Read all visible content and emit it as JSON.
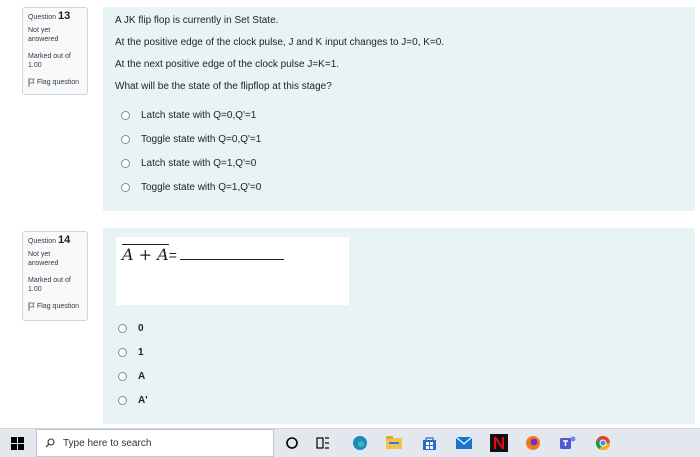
{
  "q13": {
    "label": "Question",
    "number": "13",
    "state": "Not yet answered",
    "mark": "Marked out of 1.00",
    "flag": "Flag question",
    "text": [
      "A JK flip flop is currently in Set State.",
      "At the positive edge of the clock pulse, J and K input changes to J=0, K=0.",
      "At the next positive edge of the clock pulse J=K=1.",
      "What will be the state of the flipflop at this stage?"
    ],
    "options": [
      "Latch state with Q=0,Q'=1",
      "Toggle state with Q=0,Q'=1",
      "Latch state with Q=1,Q'=0",
      "Toggle state with Q=1,Q'=0"
    ]
  },
  "q14": {
    "label": "Question",
    "number": "14",
    "state": "Not yet answered",
    "mark": "Marked out of 1.00",
    "flag": "Flag question",
    "formula": {
      "a": "A",
      "plus": "+",
      "abar": "A",
      "eq": "="
    },
    "options": [
      "0",
      "1",
      "A",
      "A'"
    ]
  },
  "taskbar": {
    "search_placeholder": "Type here to search",
    "icons": [
      "windows-start-icon",
      "cortana-icon",
      "task-view-icon",
      "edge-icon",
      "file-explorer-icon",
      "store-icon",
      "mail-icon",
      "netflix-icon",
      "firefox-icon",
      "teams-icon",
      "chrome-icon"
    ],
    "colors": {
      "edge": "#1e88c9",
      "explorer": "#f2c14e",
      "store": "#2b6cc4",
      "mail": "#1a73c8",
      "netflix": "#111111",
      "firefox": "#f07b1f",
      "teams": "#5059c9",
      "chrome": "#f4b400"
    }
  }
}
